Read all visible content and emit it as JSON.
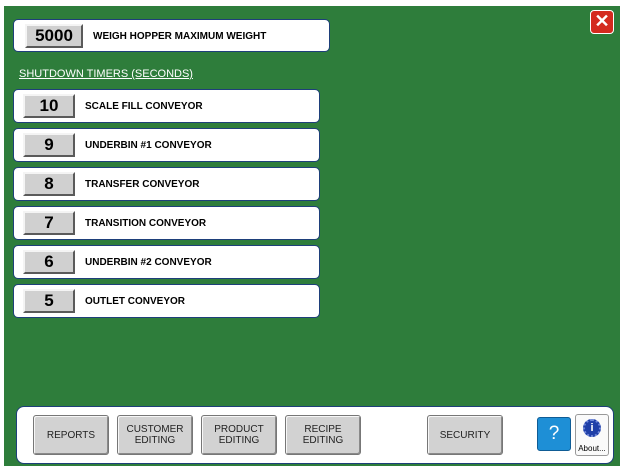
{
  "max_weight": {
    "value": "5000",
    "label": "WEIGH HOPPER MAXIMUM WEIGHT"
  },
  "section_title": "SHUTDOWN TIMERS (SECONDS)",
  "timers": [
    {
      "value": "10",
      "label": "SCALE FILL CONVEYOR"
    },
    {
      "value": "9",
      "label": "UNDERBIN #1 CONVEYOR"
    },
    {
      "value": "8",
      "label": "TRANSFER CONVEYOR"
    },
    {
      "value": "7",
      "label": "TRANSITION CONVEYOR"
    },
    {
      "value": "6",
      "label": "UNDERBIN #2 CONVEYOR"
    },
    {
      "value": "5",
      "label": "OUTLET CONVEYOR"
    }
  ],
  "close": {
    "symbol": "✕",
    "icon": "close-icon"
  },
  "nav": {
    "reports": "REPORTS",
    "customer_editing": "CUSTOMER\nEDITING",
    "product_editing": "PRODUCT\nEDITING",
    "recipe_editing": "RECIPE\nEDITING",
    "security": "SECURITY",
    "help_symbol": "?",
    "about_symbol": "i",
    "about_label": "About..."
  },
  "colors": {
    "background": "#2e7d3b",
    "close_red": "#d42a1f",
    "help_blue": "#1e8fd6",
    "border_navy": "#1e3f7a"
  }
}
